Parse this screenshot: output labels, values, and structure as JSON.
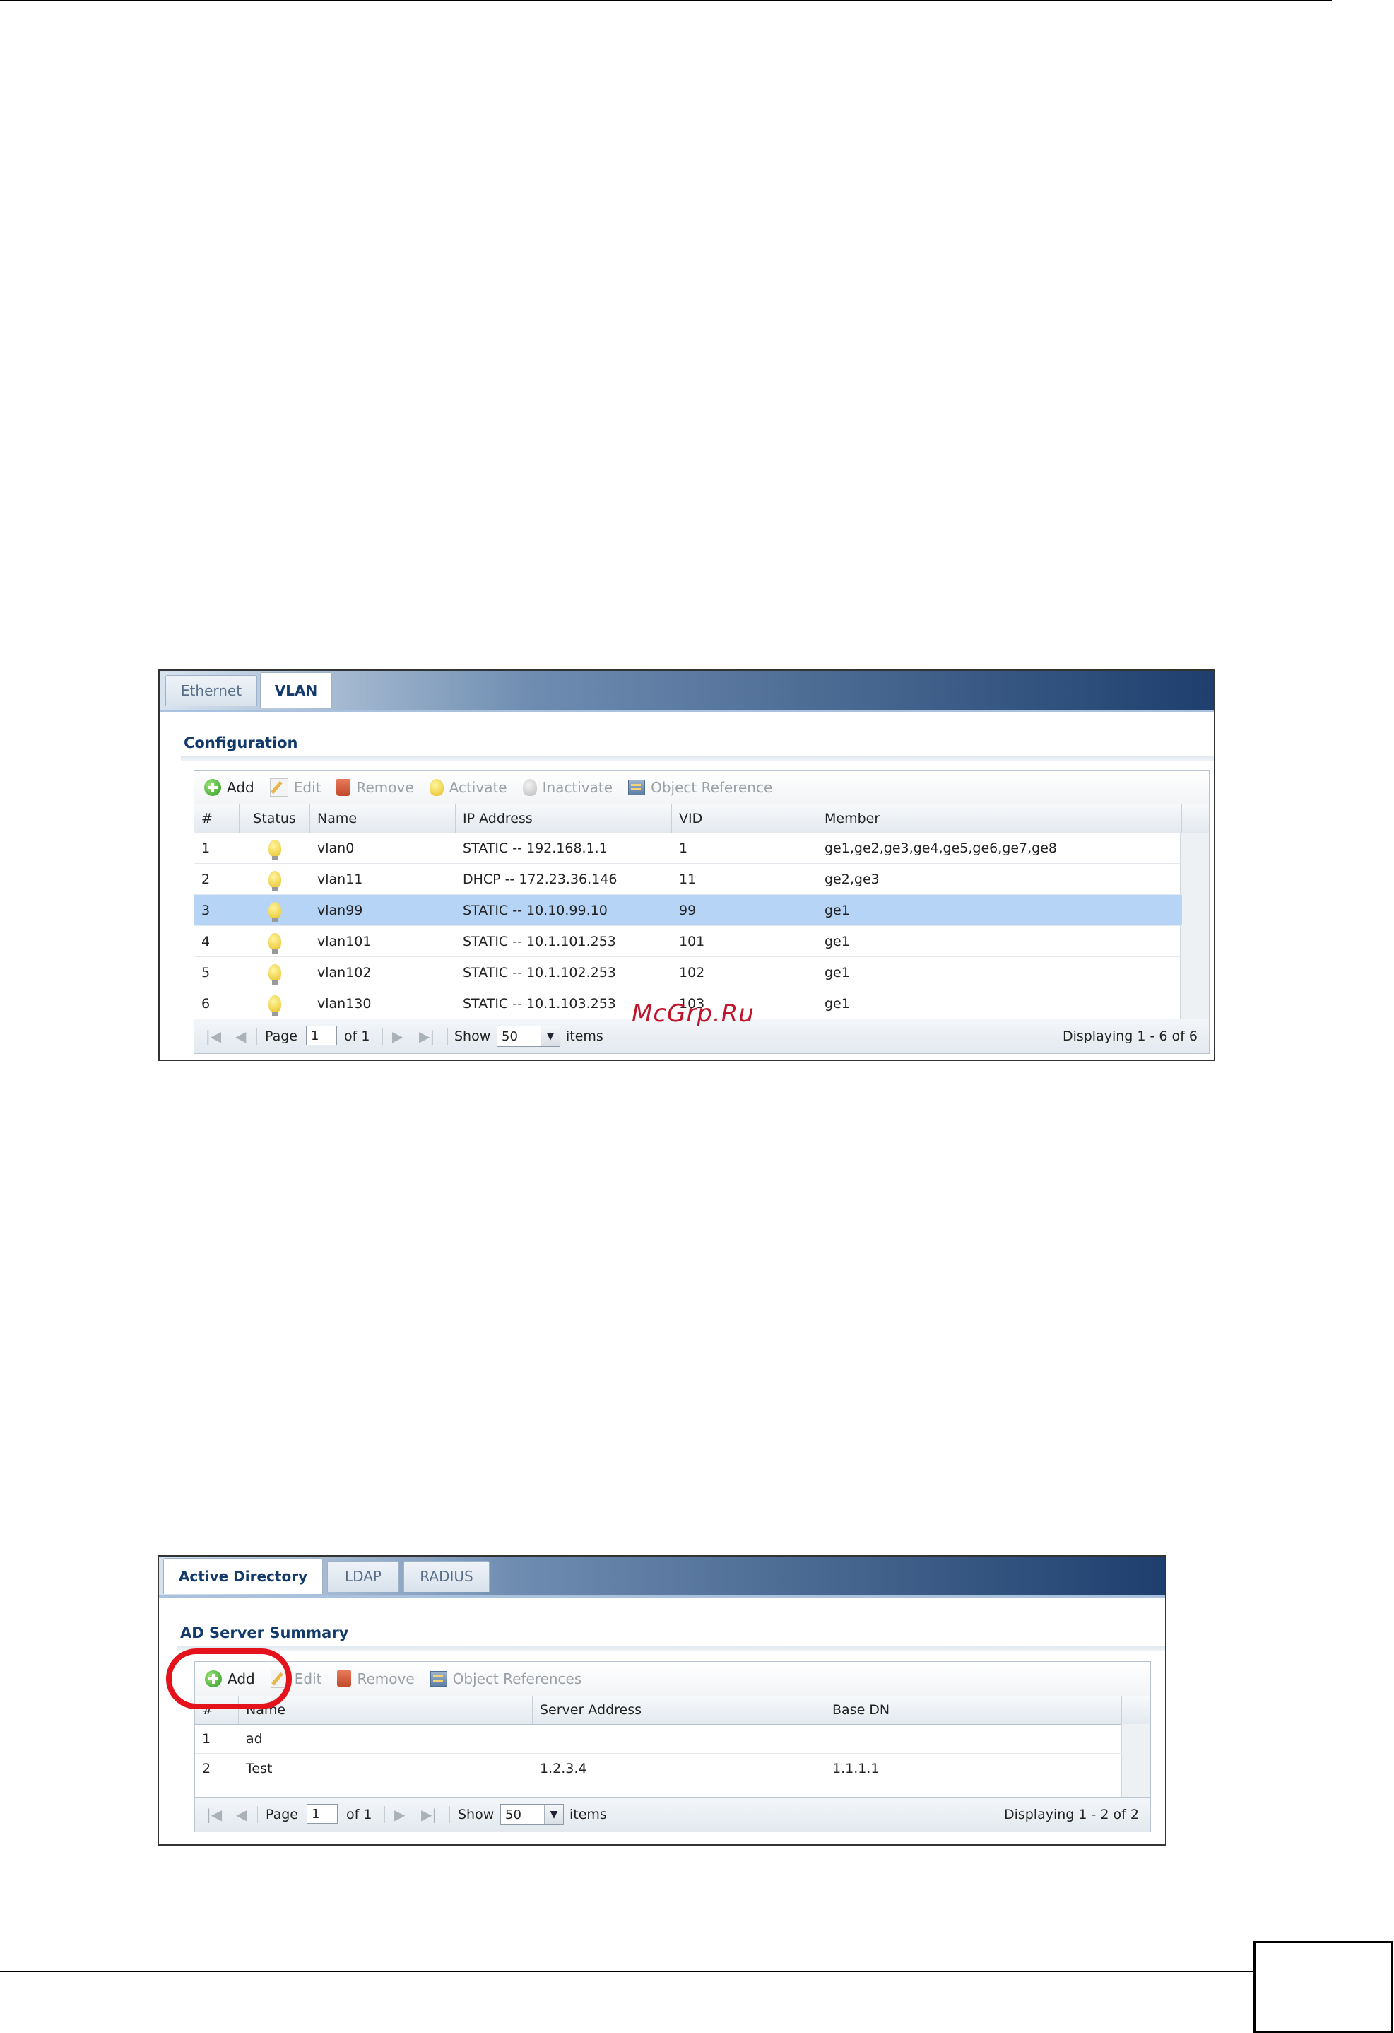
{
  "vlan_screen": {
    "tabs": [
      "Ethernet",
      "VLAN"
    ],
    "active_tab": "VLAN",
    "section_title": "Configuration",
    "toolbar": [
      "Add",
      "Edit",
      "Remove",
      "Activate",
      "Inactivate",
      "Object Reference"
    ],
    "columns": [
      "#",
      "Status",
      "Name",
      "IP Address",
      "VID",
      "Member"
    ],
    "rows": [
      {
        "num": "1",
        "name": "vlan0",
        "ip": "STATIC -- 192.168.1.1",
        "vid": "1",
        "member": "ge1,ge2,ge3,ge4,ge5,ge6,ge7,ge8"
      },
      {
        "num": "2",
        "name": "vlan11",
        "ip": "DHCP -- 172.23.36.146",
        "vid": "11",
        "member": "ge2,ge3"
      },
      {
        "num": "3",
        "name": "vlan99",
        "ip": "STATIC -- 10.10.99.10",
        "vid": "99",
        "member": "ge1"
      },
      {
        "num": "4",
        "name": "vlan101",
        "ip": "STATIC -- 10.1.101.253",
        "vid": "101",
        "member": "ge1"
      },
      {
        "num": "5",
        "name": "vlan102",
        "ip": "STATIC -- 10.1.102.253",
        "vid": "102",
        "member": "ge1"
      },
      {
        "num": "6",
        "name": "vlan130",
        "ip": "STATIC -- 10.1.103.253",
        "vid": "103",
        "member": "ge1"
      }
    ],
    "selected_row": 3,
    "pager": {
      "page_label": "Page",
      "page_value": "1",
      "of_label": "of 1",
      "show_label": "Show",
      "show_value": "50",
      "items_label": "items",
      "display_text": "Displaying 1 - 6 of 6"
    }
  },
  "ad_screen": {
    "tabs": [
      "Active Directory",
      "LDAP",
      "RADIUS"
    ],
    "active_tab": "Active Directory",
    "section_title": "AD Server Summary",
    "toolbar": [
      "Add",
      "Edit",
      "Remove",
      "Object References"
    ],
    "columns": [
      "#",
      "Name",
      "Server Address",
      "Base DN"
    ],
    "rows": [
      {
        "num": "1",
        "name": "ad",
        "server": "",
        "base_dn": ""
      },
      {
        "num": "2",
        "name": "Test",
        "server": "1.2.3.4",
        "base_dn": "1.1.1.1"
      }
    ],
    "pager": {
      "page_label": "Page",
      "page_value": "1",
      "of_label": "of 1",
      "show_label": "Show",
      "show_value": "50",
      "items_label": "items",
      "display_text": "Displaying 1 - 2 of 2"
    }
  },
  "watermark": "McGrp.Ru",
  "colors": {
    "accent": "#123a6b",
    "selected_row": "#b6d4f6",
    "highlight_ring": "#e3121b",
    "watermark": "#c0162d"
  }
}
